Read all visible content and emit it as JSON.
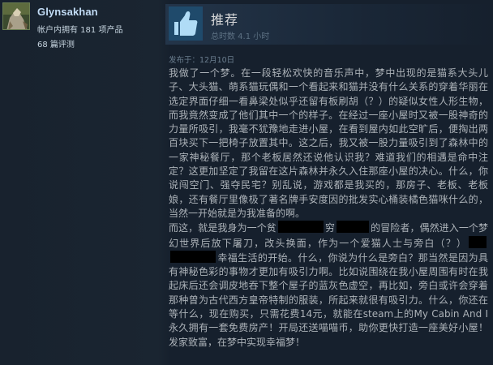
{
  "author": {
    "persona_name": "Glynsakhan",
    "owned_games": "帐户内拥有 181 项产品",
    "review_count": "68 篇评测",
    "avatar_icon": "avatar-image"
  },
  "vote": {
    "verdict": "推荐",
    "icon": "thumbs-up-icon",
    "playtime": "总时数 4.1 小时",
    "accent_color": "#1f4a6b"
  },
  "posted": "发布于：12月10日",
  "review": {
    "para1": "我做了一个梦。在一段轻松欢快的音乐声中，梦中出现的是猫系大头儿子、大头猫、萌系猫玩偶和一个看起来和猫并没有什么关系的穿着华丽在选定界面仔细一看鼻梁处似乎还留有板刷胡（？）的疑似女性人形生物，而我竟然变成了他们其中一个的样子。在经过一座小屋时又被一股神奇的力量所吸引，我毫不犹豫地走进小屋，在看到屋内如此空旷后，便掏出两百块买下一把椅子放置其中。这之后，我又被一股力量吸引到了森林中的一家神秘餐厅，那个老板居然还说他认识我？难道我们的相遇是命中注定？这更加坚定了我留在这片森林并永久入住那座小屋的决心。什么，你说闯空门、强夺民宅？别乱说，游戏都是我买的，那房子、老板、老板娘，还有餐厅里像极了著名牌手安度因的批发实心桶装橘色猫咪什么的，当然一开始就是为我准备的啊。",
    "para2_a": "而这，就是我身为一个贫",
    "para2_b": "穷",
    "para2_c": "的冒险者，偶然进入一个梦幻世界后放下屠刀，改头换面，作为一个爱猫人士与旁白（？）",
    "para2_d": "幸福生活的开始。什么，你说为什么是旁白？那当然是因为具有神秘色彩的事物才更加有吸引力啊。比如说围绕在我小屋周围有时在我起床后还会调皮地吞下整个屋子的蓝灰色虚空，再比如，旁白或许会穿着那种曾为古代西方皇帝特制的服装，所起来就很有吸引力。什么，你还在等什么，现在购买，只需花费14元，就能在steam上的My Cabin And I永久拥有一套免费房产！开局还送喵喵币，助你更快打造一座美好小屋！发家致富，在梦中实现幸福梦！"
  }
}
